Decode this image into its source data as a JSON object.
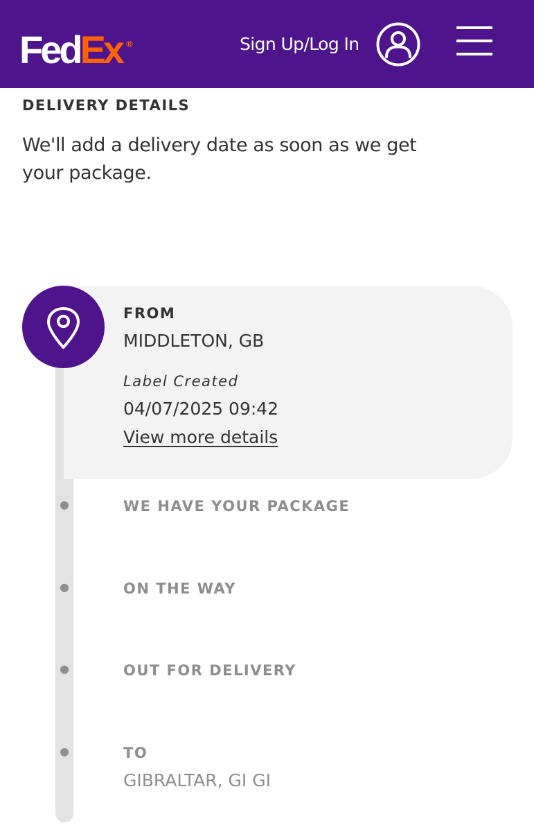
{
  "header": {
    "logo": {
      "fed": "Fed",
      "ex": "Ex",
      "registered": "®"
    },
    "signin_label": "Sign Up/Log In",
    "user_icon": "user-circle-icon",
    "menu_icon": "hamburger-menu-icon"
  },
  "delivery": {
    "title": "DELIVERY DETAILS",
    "message": "We'll add a delivery date as soon as we get your package."
  },
  "timeline": {
    "from": {
      "label": "FROM",
      "location": "MIDDLETON, GB",
      "status": "Label Created",
      "datetime": "04/07/2025 09:42",
      "link": "View more details",
      "icon": "location-pin-icon"
    },
    "steps": [
      {
        "label": "WE HAVE YOUR PACKAGE"
      },
      {
        "label": "ON THE WAY"
      },
      {
        "label": "OUT FOR DELIVERY"
      }
    ],
    "to": {
      "label": "TO",
      "location": "GIBRALTAR, GI GI"
    }
  },
  "colors": {
    "brand_purple": "#4d148c",
    "brand_orange": "#ff6200",
    "card_background": "#f3f3f3",
    "inactive_text": "#8e8e8e",
    "track_line": "#e3e3e3"
  }
}
